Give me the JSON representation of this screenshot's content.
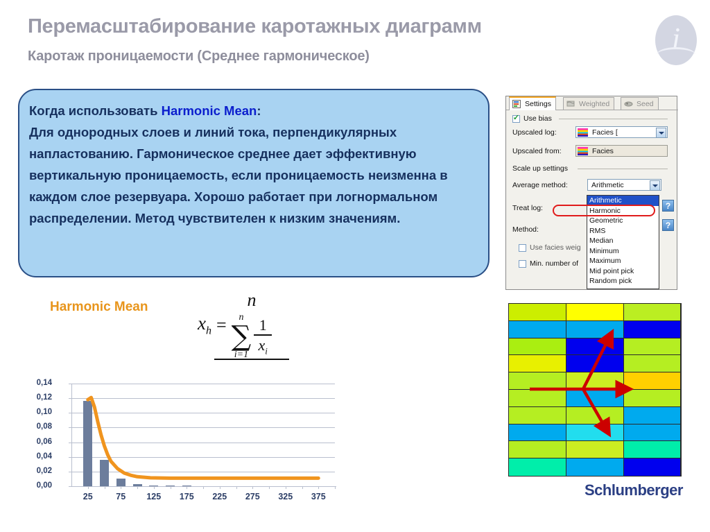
{
  "header": {
    "title": "Перемасштабирование каротажных диаграмм",
    "subtitle": "Каротаж проницаемости (Среднее гармоническое)",
    "info_icon": "info-circle-icon"
  },
  "callout": {
    "lead_prefix": "Когда использовать ",
    "lead_highlight": "Harmonic Mean",
    "lead_suffix": ":",
    "body": "Для однородных слоев и линий тока, перпендикулярных напластованию. Гармоническое среднее дает эффективную вертикальную проницаемость, если проницаемость неизменна в каждом слое резервуара. Хорошо работает при логнормальном распределении. Метод чувствителен к низким значениям."
  },
  "formula": {
    "label": "Harmonic Mean",
    "lhs_var": "x",
    "lhs_sub": "h",
    "equals": "=",
    "numerator": "n",
    "sigma_top": "n",
    "sigma_symbol": "∑",
    "sigma_bottom": "i=1",
    "inner_numerator": "1",
    "inner_denominator": "x",
    "inner_denominator_sub": "i"
  },
  "dialog": {
    "tabs": [
      {
        "label": "Settings",
        "icon": "settings-icon",
        "active": true
      },
      {
        "label": "Weighted",
        "icon": "flag-icon",
        "active": false
      },
      {
        "label": "Seed",
        "icon": "seed-icon",
        "active": false
      }
    ],
    "use_bias": {
      "label": "Use bias",
      "checked": true
    },
    "upscaled_log": {
      "label": "Upscaled log:",
      "value": "Facies ["
    },
    "upscaled_from": {
      "label": "Upscaled from:",
      "value": "Facies"
    },
    "scale_up_settings_label": "Scale up settings",
    "average_method": {
      "label": "Average method:",
      "value": "Arithmetic"
    },
    "treat_log": {
      "label": "Treat log:"
    },
    "method": {
      "label": "Method:"
    },
    "use_facies_weight": {
      "label": "Use facies weig",
      "checked": false
    },
    "min_number": {
      "label": "Min. number of",
      "checked": false
    },
    "help_label": "?",
    "dropdown": {
      "options": [
        "Arithmetic",
        "Harmonic",
        "Geometric",
        "RMS",
        "Median",
        "Minimum",
        "Maximum",
        "Mid point pick",
        "Random pick"
      ],
      "selected": "Arithmetic",
      "highlighted": "Harmonic"
    }
  },
  "chart_data": {
    "type": "bar",
    "title": "",
    "xlabel": "",
    "ylabel": "",
    "ylim": [
      0,
      0.14
    ],
    "ytick_labels": [
      "0,00",
      "0,02",
      "0,04",
      "0,06",
      "0,08",
      "0,10",
      "0,12",
      "0,14"
    ],
    "ytick_values": [
      0,
      0.02,
      0.04,
      0.06,
      0.08,
      0.1,
      0.12,
      0.14
    ],
    "xtick_labels": [
      "25",
      "75",
      "125",
      "175",
      "225",
      "275",
      "325",
      "375"
    ],
    "xtick_values": [
      25,
      75,
      125,
      175,
      225,
      275,
      325,
      375
    ],
    "xlim": [
      0,
      400
    ],
    "grid": true,
    "legend": "none",
    "categories": [
      25,
      50,
      75,
      100,
      125,
      150,
      175,
      200,
      225,
      250,
      275,
      300,
      325,
      350,
      375
    ],
    "values": [
      0.116,
      0.036,
      0.01,
      0.003,
      0.001,
      0.0004,
      0.0002,
      0,
      0,
      0,
      0,
      0,
      0,
      0,
      0
    ],
    "series": [
      {
        "name": "histogram",
        "type": "bar",
        "color": "#6c7d9c",
        "values": [
          0.116,
          0.036,
          0.01,
          0.003,
          0.001,
          0.0004,
          0.0002,
          0,
          0,
          0,
          0,
          0,
          0,
          0,
          0
        ]
      },
      {
        "name": "fitted-curve",
        "type": "line",
        "color": "#f0941e",
        "x": [
          25,
          30,
          35,
          40,
          45,
          50,
          55,
          60,
          70,
          80,
          90,
          100,
          120,
          150,
          200,
          250,
          300,
          350,
          375
        ],
        "y": [
          0.118,
          0.121,
          0.108,
          0.088,
          0.07,
          0.055,
          0.043,
          0.034,
          0.024,
          0.018,
          0.015,
          0.013,
          0.0115,
          0.011,
          0.011,
          0.011,
          0.011,
          0.011,
          0.011
        ]
      }
    ]
  },
  "facies_grid": {
    "name": "facies-column-grid",
    "columns": 3,
    "rows": 10,
    "colors": [
      [
        "#ccee00",
        "#ffff00",
        "#bbee22"
      ],
      [
        "#00aaee",
        "#00aaee",
        "#0000ee"
      ],
      [
        "#aaee11",
        "#0000ee",
        "#b5ee22"
      ],
      [
        "#e8f000",
        "#0000ee",
        "#b5ee22"
      ],
      [
        "#b5ee22",
        "#ccee22",
        "#ffd000"
      ],
      [
        "#b5ee22",
        "#00aaee",
        "#b5ee22"
      ],
      [
        "#b5ee22",
        "#b5ee22",
        "#00aaee"
      ],
      [
        "#00aaee",
        "#22ddee",
        "#00aaee"
      ],
      [
        "#b5ee22",
        "#ccee22",
        "#00eeaa"
      ],
      [
        "#00eeaa",
        "#00aaee",
        "#0000ee"
      ]
    ],
    "arrow_color": "#cc0000",
    "arrows": [
      "horizontal-right",
      "diagonal-up-right",
      "diagonal-down-right"
    ]
  },
  "logo": {
    "text": "Schlumberger"
  }
}
